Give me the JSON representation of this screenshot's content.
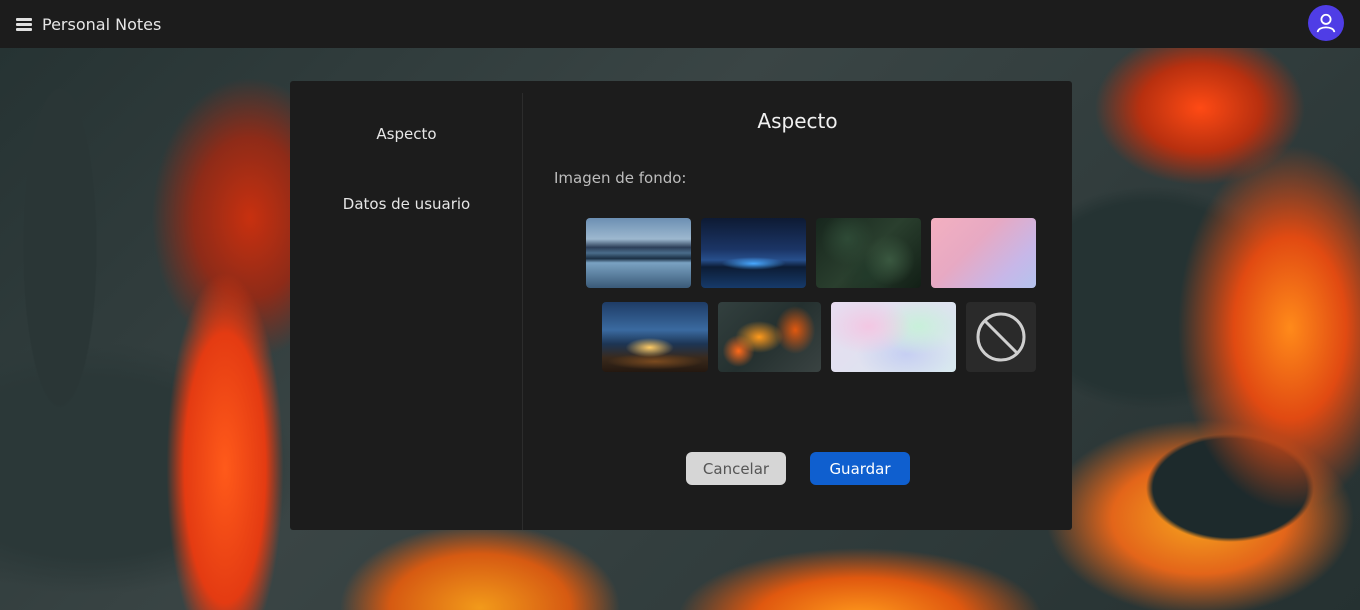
{
  "app": {
    "title": "Personal Notes",
    "menu_icon": "hamburger-menu-icon",
    "avatar_icon": "user-icon",
    "accent_color": "#4f3de6"
  },
  "dialog": {
    "sidebar": {
      "items": [
        {
          "label": "Aspecto"
        },
        {
          "label": "Datos de usuario"
        }
      ]
    },
    "title": "Aspecto",
    "background_label": "Imagen de fondo:",
    "backgrounds": [
      {
        "name": "mountain-lake"
      },
      {
        "name": "night-city-skyline"
      },
      {
        "name": "dark-leaves"
      },
      {
        "name": "pink-gradient"
      },
      {
        "name": "beach-dinner"
      },
      {
        "name": "lava-marble"
      },
      {
        "name": "pastel-gradient"
      },
      {
        "name": "no-background",
        "icon": "no-image-icon"
      }
    ],
    "cancel_label": "Cancelar",
    "save_label": "Guardar",
    "save_color": "#0f5fcf"
  }
}
